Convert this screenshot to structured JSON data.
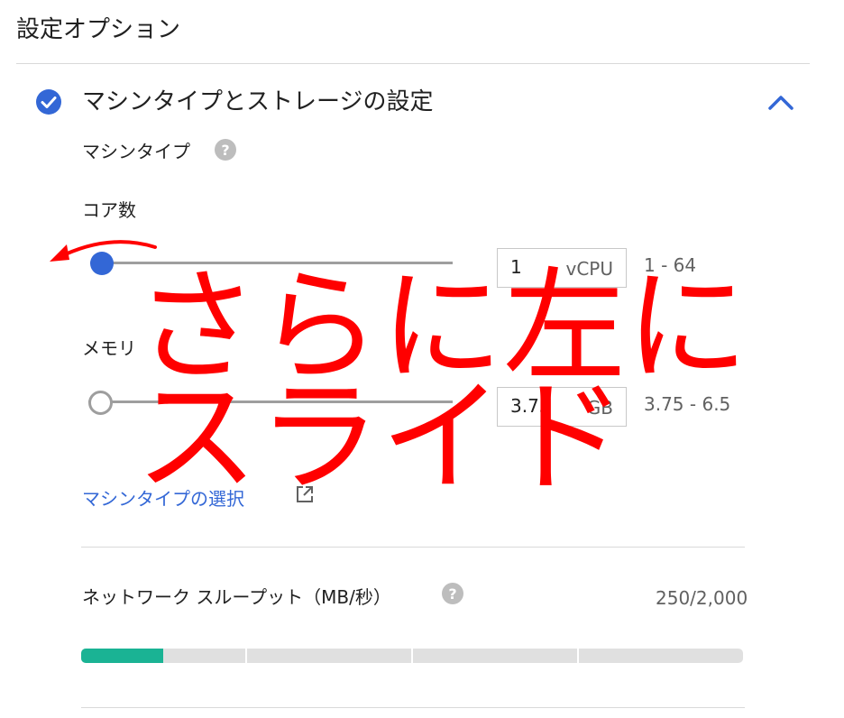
{
  "page": {
    "section_title": "設定オプション"
  },
  "panel": {
    "title": "マシンタイプとストレージの設定",
    "machine_type_label": "マシンタイプ"
  },
  "cores": {
    "label": "コア数",
    "value": "1",
    "unit": "vCPU",
    "range": "1 - 64",
    "slider_position_fraction": 0.0
  },
  "memory": {
    "label": "メモリ",
    "value": "3.75",
    "unit": "GB",
    "range": "3.75 - 6.5",
    "slider_position_fraction": 0.0
  },
  "machine_type_link": "マシンタイプの選択",
  "network": {
    "label": "ネットワーク スループット（MB/秒）",
    "value": "250/2,000",
    "fill_fraction": 0.125
  },
  "annotation": {
    "line1": "さらに左に",
    "line2": "スライド"
  },
  "colors": {
    "accent": "#3367d6",
    "annotation": "#ff0000",
    "throughput_fill": "#1ab394"
  },
  "icons": {
    "check": "check-circle-icon",
    "collapse": "chevron-up-icon",
    "help": "help-icon",
    "external_link": "external-link-icon",
    "annotation_arrow": "curved-arrow-left"
  }
}
